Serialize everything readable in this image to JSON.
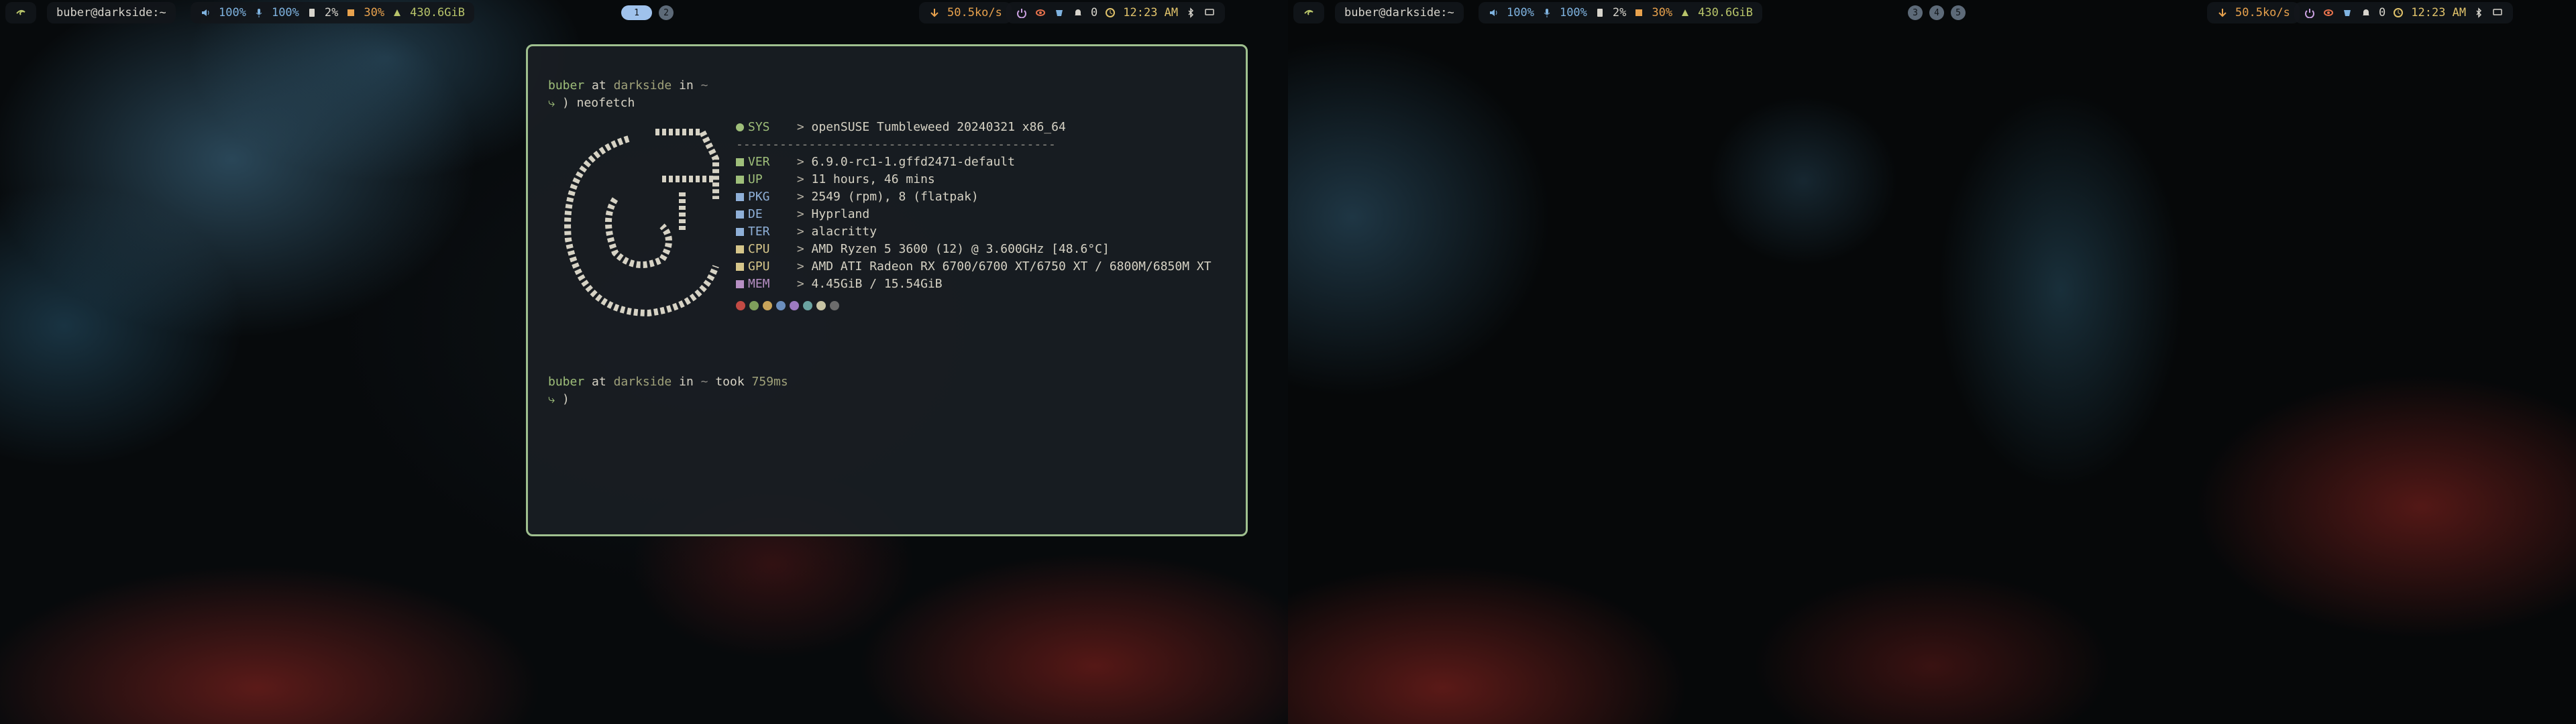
{
  "bar": {
    "user_host": "buber@darkside:~",
    "volume": "100%",
    "mic": "100%",
    "cpu": "2%",
    "memory": "30%",
    "disk": "430.6GiB",
    "net": "50.5ko/s",
    "notifications": "0",
    "clock": "12:23 AM",
    "workspaces_left": [
      "1",
      "2"
    ],
    "workspaces_right": [
      "3",
      "4",
      "5"
    ]
  },
  "terminal": {
    "prompt1": {
      "user": "buber",
      "at": "at",
      "host": "darkside",
      "in": "in",
      "dir": "~"
    },
    "command": "neofetch",
    "sys_info": [
      {
        "key": "SYS",
        "value": "openSUSE Tumbleweed 20240321 x86_64",
        "icon": "opensuse-icon",
        "color": "#9fbf7a"
      },
      {
        "key": "VER",
        "value": "6.9.0-rc1-1.gffd2471-default",
        "icon": "kernel-icon",
        "color": "#9fbf7a"
      },
      {
        "key": "UP",
        "value": "11 hours, 46 mins",
        "icon": "uptime-icon",
        "color": "#9fbf7a"
      },
      {
        "key": "PKG",
        "value": "2549 (rpm), 8 (flatpak)",
        "icon": "package-icon",
        "color": "#8fb0d8"
      },
      {
        "key": "DE",
        "value": "Hyprland",
        "icon": "desktop-icon",
        "color": "#8fb0d8"
      },
      {
        "key": "TER",
        "value": "alacritty",
        "icon": "terminal-icon",
        "color": "#8fb0d8"
      },
      {
        "key": "CPU",
        "value": "AMD Ryzen 5 3600 (12) @ 3.600GHz [48.6°C]",
        "icon": "cpu-icon",
        "color": "#d6c68a"
      },
      {
        "key": "GPU",
        "value": "AMD ATI Radeon RX 6700/6700 XT/6750 XT / 6800M/6850M XT",
        "icon": "gpu-icon",
        "color": "#d6c68a"
      },
      {
        "key": "MEM",
        "value": "4.45GiB / 15.54GiB",
        "icon": "memory-icon",
        "color": "#b78fc4"
      }
    ],
    "separator": "--------------------------------------------",
    "palette": [
      "#c24a44",
      "#7f9f5b",
      "#c9a45a",
      "#6b8fbf",
      "#9d7ac0",
      "#6aa3a1",
      "#c8c4a4",
      "#6c6c6c"
    ],
    "prompt2": {
      "user": "buber",
      "at": "at",
      "host": "darkside",
      "in": "in",
      "dir": "~",
      "took": "took",
      "duration": "759ms"
    },
    "prompt_arrow": ")"
  }
}
